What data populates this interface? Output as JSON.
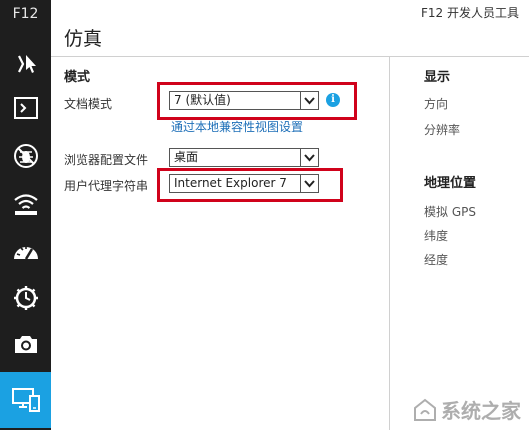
{
  "sidebar": {
    "label": "F12",
    "tools": [
      {
        "name": "dom-explorer",
        "icon": "pointer-icon"
      },
      {
        "name": "console",
        "icon": "console-icon"
      },
      {
        "name": "debugger",
        "icon": "bug-icon"
      },
      {
        "name": "network",
        "icon": "wifi-icon"
      },
      {
        "name": "ui-responsiveness",
        "icon": "gauge-icon"
      },
      {
        "name": "profiler",
        "icon": "clock-icon"
      },
      {
        "name": "memory",
        "icon": "camera-icon"
      },
      {
        "name": "emulation",
        "icon": "devices-icon",
        "active": true
      }
    ]
  },
  "header": {
    "app_title": "F12 开发人员工具",
    "page_title": "仿真"
  },
  "mode_section": {
    "heading": "模式",
    "document_mode": {
      "label": "文档模式",
      "value": "7 (默认值)",
      "link": "通过本地兼容性视图设置"
    },
    "browser_profile": {
      "label": "浏览器配置文件",
      "value": "桌面"
    },
    "user_agent": {
      "label": "用户代理字符串",
      "value": "Internet Explorer 7"
    }
  },
  "display_section": {
    "heading": "显示",
    "items": [
      "方向",
      "分辨率"
    ]
  },
  "geo_section": {
    "heading": "地理位置",
    "items": [
      "模拟 GPS",
      "纬度",
      "经度"
    ]
  },
  "watermark": {
    "text": "系统之家"
  },
  "colors": {
    "sidebar": "#1e1e1e",
    "accent": "#1ba1e2",
    "highlight": "#d0021b",
    "link": "#1e6fb8"
  }
}
